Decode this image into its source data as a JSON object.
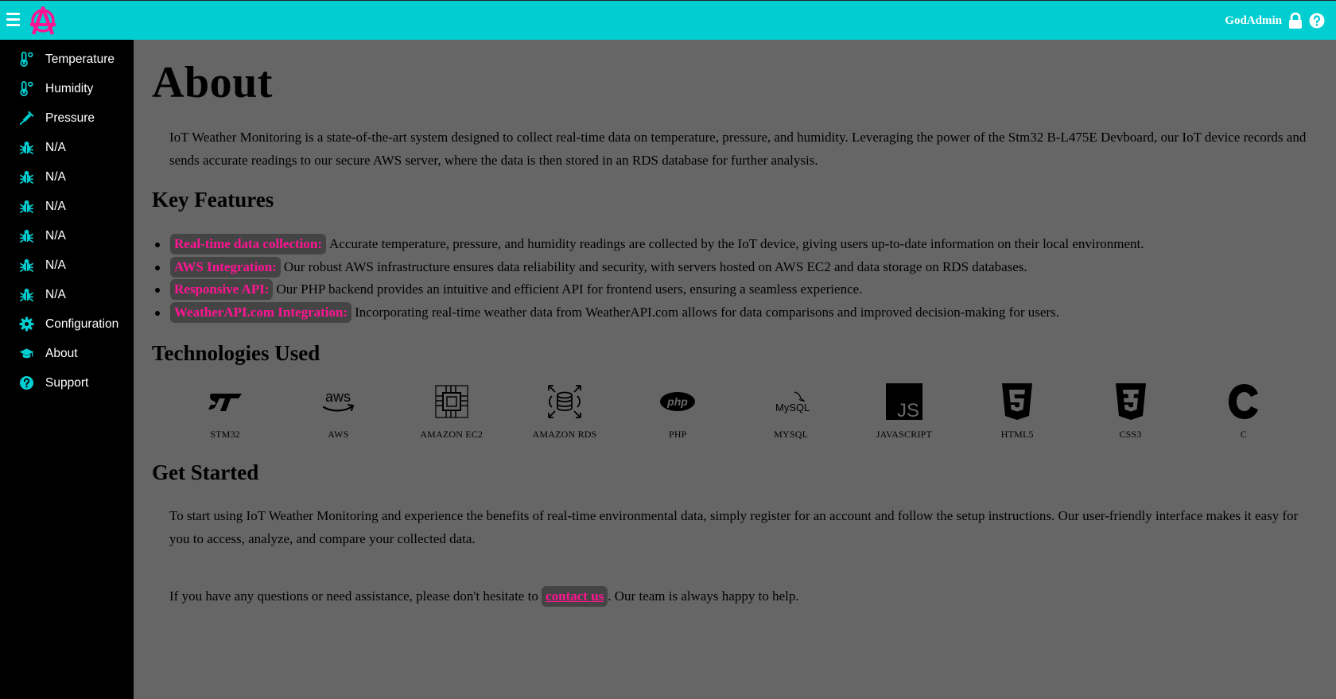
{
  "header": {
    "username": "GodAdmin",
    "menu_icon": "hamburger-menu-icon",
    "logo_icon": "anarchy-a-logo",
    "lock_icon": "lock-icon",
    "help_icon": "question-circle-icon",
    "accent_color": "#00CED1",
    "brand_color": "#FF1493"
  },
  "sidebar": {
    "items": [
      {
        "label": "Temperature",
        "icon": "thermometer-icon"
      },
      {
        "label": "Humidity",
        "icon": "thermometer-icon"
      },
      {
        "label": "Pressure",
        "icon": "syringe-icon"
      },
      {
        "label": "N/A",
        "icon": "bug-icon"
      },
      {
        "label": "N/A",
        "icon": "bug-icon"
      },
      {
        "label": "N/A",
        "icon": "bug-icon"
      },
      {
        "label": "N/A",
        "icon": "bug-icon"
      },
      {
        "label": "N/A",
        "icon": "bug-icon"
      },
      {
        "label": "N/A",
        "icon": "bug-icon"
      },
      {
        "label": "Configuration",
        "icon": "gear-icon"
      },
      {
        "label": "About",
        "icon": "graduation-cap-icon"
      },
      {
        "label": "Support",
        "icon": "question-circle-icon"
      }
    ]
  },
  "main": {
    "title": "About",
    "intro": "IoT Weather Monitoring is a state-of-the-art system designed to collect real-time data on temperature, pressure, and humidity. Leveraging the power of the Stm32 B-L475E Devboard, our IoT device records and sends accurate readings to our secure AWS server, where the data is then stored in an RDS database for further analysis.",
    "key_features_heading": "Key Features",
    "features": [
      {
        "title": "Real-time data collection:",
        "text": "Accurate temperature, pressure, and humidity readings are collected by the IoT device, giving users up-to-date information on their local environment."
      },
      {
        "title": "AWS Integration:",
        "text": "Our robust AWS infrastructure ensures data reliability and security, with servers hosted on AWS EC2 and data storage on RDS databases."
      },
      {
        "title": "Responsive API:",
        "text": "Our PHP backend provides an intuitive and efficient API for frontend users, ensuring a seamless experience."
      },
      {
        "title": "WeatherAPI.com Integration:",
        "text": "Incorporating real-time weather data from WeatherAPI.com allows for data comparisons and improved decision-making for users."
      }
    ],
    "technologies_heading": "Technologies Used",
    "technologies": [
      {
        "label": "STM32",
        "icon": "stm32-logo-icon"
      },
      {
        "label": "AWS",
        "icon": "aws-logo-icon"
      },
      {
        "label": "AMAZON EC2",
        "icon": "chip-icon"
      },
      {
        "label": "AMAZON RDS",
        "icon": "database-icon"
      },
      {
        "label": "PHP",
        "icon": "php-logo-icon"
      },
      {
        "label": "MYSQL",
        "icon": "mysql-logo-icon"
      },
      {
        "label": "JAVASCRIPT",
        "icon": "js-logo-icon"
      },
      {
        "label": "HTML5",
        "icon": "html5-logo-icon"
      },
      {
        "label": "CSS3",
        "icon": "css3-logo-icon"
      },
      {
        "label": "C",
        "icon": "c-logo-icon"
      }
    ],
    "get_started_heading": "Get Started",
    "get_started_text": "To start using IoT Weather Monitoring and experience the benefits of real-time environmental data, simply register for an account and follow the setup instructions. Our user-friendly interface makes it easy for you to access, analyze, and compare your collected data.",
    "contact_before": "If you have any questions or need assistance, please don't hesitate to ",
    "contact_link": "contact us",
    "contact_after": ". Our team is always happy to help."
  }
}
